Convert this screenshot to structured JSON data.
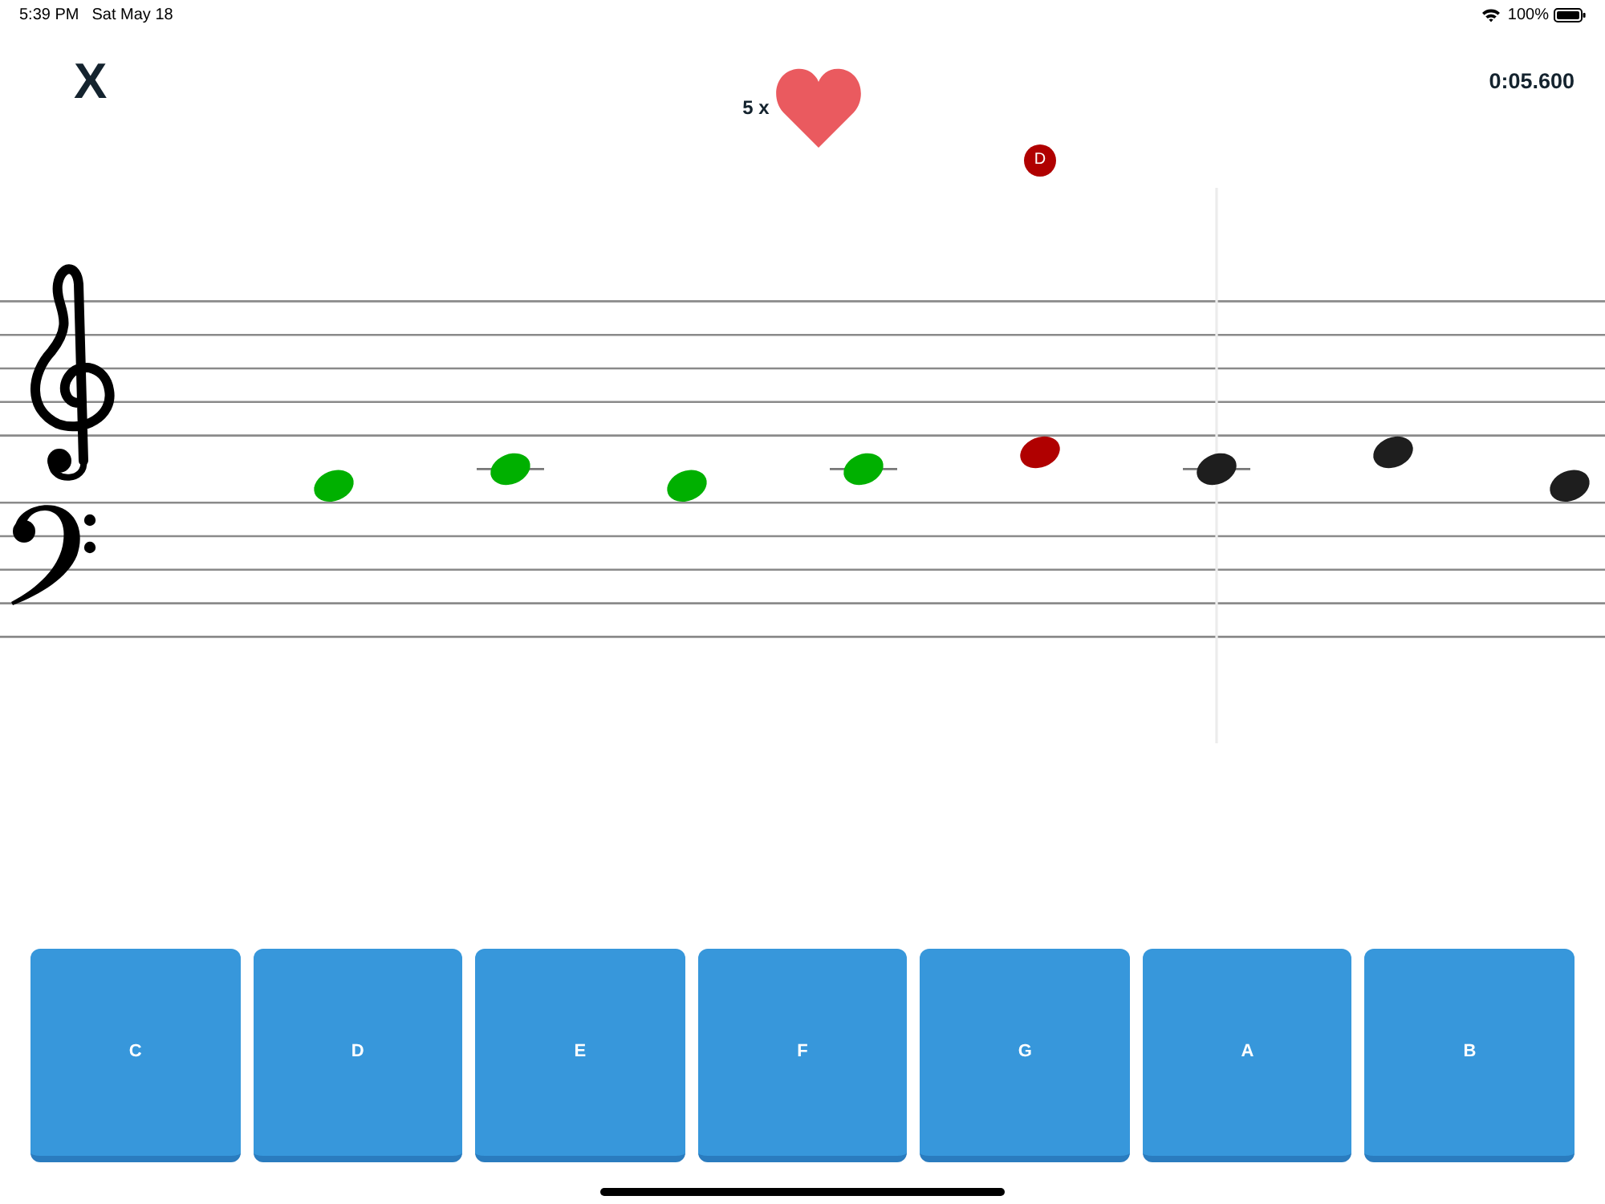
{
  "status_bar": {
    "time": "5:39 PM",
    "date": "Sat May 18",
    "battery": "100%"
  },
  "header": {
    "close": "X",
    "lives": "5 x",
    "timer": "0:05.600"
  },
  "staff": {
    "notes": [
      {
        "kind": "low",
        "color": "#00b000",
        "current": false
      },
      {
        "kind": "ledger",
        "color": "#00b000",
        "current": false
      },
      {
        "kind": "low",
        "color": "#00b000",
        "current": false
      },
      {
        "kind": "ledger",
        "color": "#00b000",
        "current": false
      },
      {
        "kind": "high",
        "color": "#b00000",
        "current": false,
        "label": "D"
      },
      {
        "kind": "ledger",
        "color": "#1e1e1e",
        "current": true
      },
      {
        "kind": "high",
        "color": "#1e1e1e",
        "current": false
      },
      {
        "kind": "low",
        "color": "#1e1e1e",
        "current": false
      }
    ]
  },
  "answer_keys": [
    {
      "label": "C"
    },
    {
      "label": "D"
    },
    {
      "label": "E"
    },
    {
      "label": "F"
    },
    {
      "label": "G"
    },
    {
      "label": "A"
    },
    {
      "label": "B"
    }
  ]
}
